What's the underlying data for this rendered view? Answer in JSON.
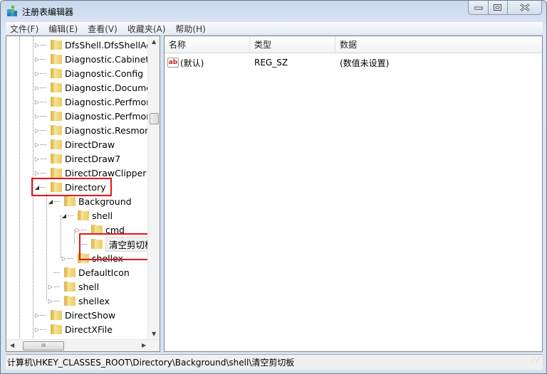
{
  "window": {
    "title": "注册表编辑器",
    "controls": [
      "minimize",
      "maximize",
      "close"
    ]
  },
  "menu": [
    "文件(F)",
    "编辑(E)",
    "查看(V)",
    "收藏夹(A)",
    "帮助(H)"
  ],
  "tree": [
    {
      "label": "DfsShell.DfsShellAdm",
      "level": 0,
      "expander": "collapsed"
    },
    {
      "label": "Diagnostic.Cabinet",
      "level": 0,
      "expander": "collapsed"
    },
    {
      "label": "Diagnostic.Config",
      "level": 0,
      "expander": "collapsed"
    },
    {
      "label": "Diagnostic.Document",
      "level": 0,
      "expander": "collapsed"
    },
    {
      "label": "Diagnostic.Perfmon.C",
      "level": 0,
      "expander": "collapsed"
    },
    {
      "label": "Diagnostic.Perfmon.D",
      "level": 0,
      "expander": "collapsed"
    },
    {
      "label": "Diagnostic.Resmon.C",
      "level": 0,
      "expander": "collapsed"
    },
    {
      "label": "DirectDraw",
      "level": 0,
      "expander": "collapsed"
    },
    {
      "label": "DirectDraw7",
      "level": 0,
      "expander": "collapsed"
    },
    {
      "label": "DirectDrawClipper",
      "level": 0,
      "expander": "collapsed"
    },
    {
      "label": "Directory",
      "level": 0,
      "expander": "expanded",
      "highlighted": true
    },
    {
      "label": "Background",
      "level": 1,
      "expander": "expanded"
    },
    {
      "label": "shell",
      "level": 2,
      "expander": "expanded"
    },
    {
      "label": "cmd",
      "level": 3,
      "expander": "collapsed"
    },
    {
      "label": "清空剪切板",
      "level": 3,
      "expander": "none",
      "selected": true,
      "highlighted": true
    },
    {
      "label": "shellex",
      "level": 2,
      "expander": "collapsed"
    },
    {
      "label": "DefaultIcon",
      "level": 1,
      "expander": "none"
    },
    {
      "label": "shell",
      "level": 1,
      "expander": "collapsed"
    },
    {
      "label": "shellex",
      "level": 1,
      "expander": "collapsed"
    },
    {
      "label": "DirectShow",
      "level": 0,
      "expander": "collapsed"
    },
    {
      "label": "DirectXFile",
      "level": 0,
      "expander": "collapsed"
    }
  ],
  "list": {
    "columns": [
      "名称",
      "类型",
      "数据"
    ],
    "rows": [
      {
        "name": "(默认)",
        "type": "REG_SZ",
        "data": "(数值未设置)",
        "icon": "string-value-icon"
      }
    ]
  },
  "status": "计算机\\HKEY_CLASSES_ROOT\\Directory\\Background\\shell\\清空剪切板",
  "scroll": {
    "hscroll_label": "III"
  },
  "colors": {
    "highlight": "#e8141a"
  }
}
